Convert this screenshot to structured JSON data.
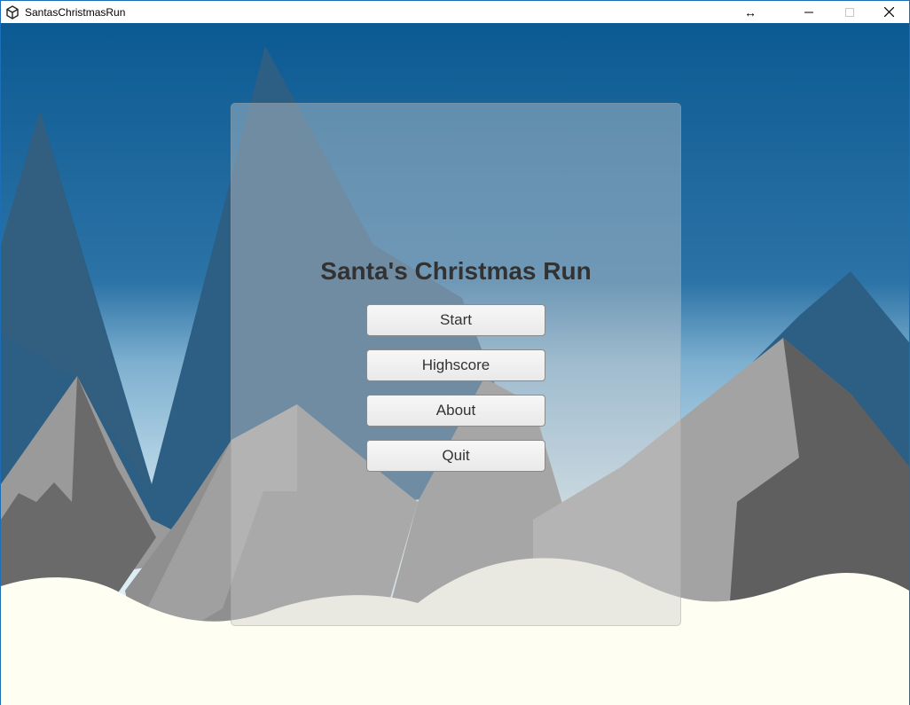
{
  "window": {
    "title": "SantasChristmasRun",
    "controls": {
      "resize": "↔",
      "minimize": "—",
      "maximize": "☐",
      "close": "✕"
    }
  },
  "menu": {
    "title": "Santa's Christmas Run",
    "buttons": [
      {
        "label": "Start"
      },
      {
        "label": "Highscore"
      },
      {
        "label": "About"
      },
      {
        "label": "Quit"
      }
    ]
  },
  "colors": {
    "sky_top": "#0c5a93",
    "sky_mid": "#7fb0d0",
    "sky_bottom": "#d6eaf2",
    "snow": "#fefef2",
    "mountain_light": "#a8a8a8",
    "mountain_dark": "#5f5f5f"
  }
}
